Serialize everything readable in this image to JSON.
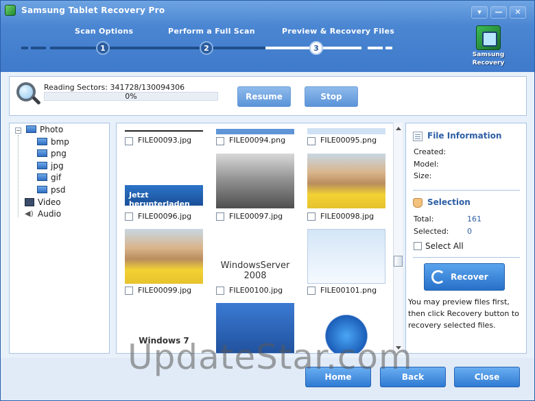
{
  "window": {
    "title": "Samsung Tablet Recovery Pro",
    "controls": [
      "▾",
      "—",
      "✕"
    ]
  },
  "steps": [
    {
      "number": "1",
      "label": "Scan Options"
    },
    {
      "number": "2",
      "label": "Perform a Full Scan"
    },
    {
      "number": "3",
      "label": "Preview & Recovery Files"
    }
  ],
  "logo": {
    "line1": "Samsung",
    "line2": "Recovery"
  },
  "progress": {
    "reading_text": "Reading Sectors: 341728/130094306",
    "percent_text": "0%",
    "percent_value": 0,
    "resume_label": "Resume",
    "stop_label": "Stop"
  },
  "tree": {
    "photo": "Photo",
    "children": [
      "bmp",
      "png",
      "jpg",
      "gif",
      "psd"
    ],
    "video": "Video",
    "audio": "Audio"
  },
  "files": [
    {
      "name": "FILE00093.jpg"
    },
    {
      "name": "FILE00094.png"
    },
    {
      "name": "FILE00095.png"
    },
    {
      "name": "FILE00096.jpg",
      "thumb_text": "Jetzt herunterladen"
    },
    {
      "name": "FILE00097.jpg"
    },
    {
      "name": "FILE00098.jpg"
    },
    {
      "name": "FILE00099.jpg"
    },
    {
      "name": "FILE00100.jpg",
      "thumb_text": "WindowsServer 2008"
    },
    {
      "name": "FILE00101.png"
    },
    {
      "name": "",
      "thumb_text": "Windows 7"
    },
    {
      "name": ""
    },
    {
      "name": ""
    }
  ],
  "file_info": {
    "title": "File Information",
    "created_label": "Created:",
    "model_label": "Model:",
    "size_label": "Size:"
  },
  "selection": {
    "title": "Selection",
    "total_label": "Total:",
    "total_value": "161",
    "selected_label": "Selected:",
    "selected_value": "0",
    "select_all_label": "Select All"
  },
  "recover_label": "Recover",
  "hint": "You may preview files first, then click Recovery button to recovery selected files.",
  "buttons": {
    "home": "Home",
    "back": "Back",
    "close": "Close"
  },
  "watermark": "UpdateStar.com"
}
